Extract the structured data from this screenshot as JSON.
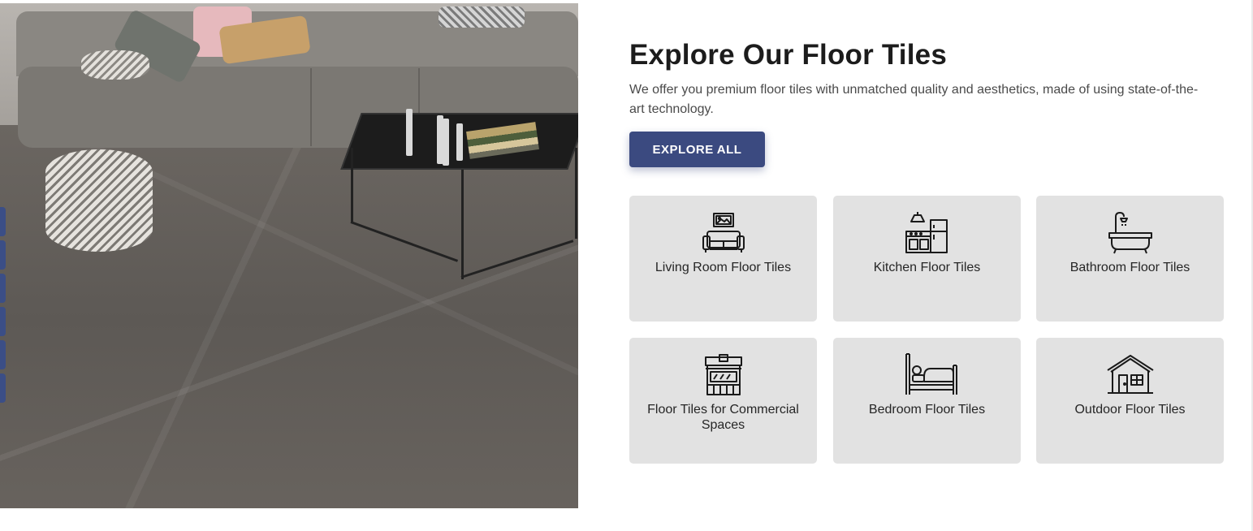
{
  "section": {
    "title": "Explore Our Floor Tiles",
    "description": "We offer you premium floor tiles with unmatched quality and aesthetics, made of using state-of-the-art technology.",
    "button_label": "EXPLORE ALL"
  },
  "categories": [
    {
      "label": "Living Room Floor Tiles",
      "icon": "living-room-icon"
    },
    {
      "label": "Kitchen Floor Tiles",
      "icon": "kitchen-icon"
    },
    {
      "label": "Bathroom Floor Tiles",
      "icon": "bathroom-icon"
    },
    {
      "label": "Floor Tiles for Commercial Spaces",
      "icon": "storefront-icon"
    },
    {
      "label": "Bedroom Floor Tiles",
      "icon": "bed-icon"
    },
    {
      "label": "Outdoor Floor Tiles",
      "icon": "house-icon"
    }
  ],
  "colors": {
    "accent": "#3b4a80",
    "card_background": "#e2e2e2",
    "title": "#1c1c1c"
  }
}
